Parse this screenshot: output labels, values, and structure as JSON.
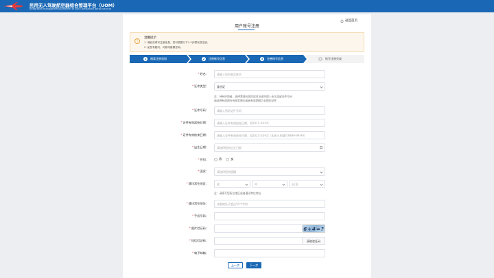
{
  "header": {
    "title": "民用无人驾驶航空器综合管理平台（UOM）",
    "subtitle": "Integrated management platform of civil unmanned aerial vehicle",
    "brand_color": "#1a68b5"
  },
  "page": {
    "home_link": "返回首页",
    "title": "用户账号注册"
  },
  "notice": {
    "title": "温馨提示",
    "lines": [
      "1. 请如实填写注册信息，您可根据以下1-5步骤完成注册。",
      "2. 如您有疑问，可致电客服咨询。"
    ]
  },
  "steps": [
    {
      "num": "1",
      "label": "阅读注册须知",
      "state": "done"
    },
    {
      "num": "2",
      "label": "注册账号信息",
      "state": "done"
    },
    {
      "num": "3",
      "label": "完善账号信息",
      "state": "current"
    },
    {
      "num": "4",
      "label": "账号注册完成",
      "state": "todo"
    }
  ],
  "form": {
    "name": {
      "label": "姓名",
      "placeholder": "请输入您的真实姓名"
    },
    "id_type": {
      "label": "证件类型",
      "value": "身份证"
    },
    "id_type_hint": [
      "注：持有护照者，选择港澳台居民居住证或外国人永久居留证件号码",
      "请选择有效期在有效范围内或者有效期限为长期的证件"
    ],
    "id_number": {
      "label": "证件号码",
      "placeholder": "请输入您的证件号码"
    },
    "valid_start": {
      "label": "证件有效起始日期",
      "placeholder": "请输入证件有效起始日期，如2021-XX-XX"
    },
    "valid_end": {
      "label": "证件有效结束日期",
      "placeholder": "请输入证件有效结束日期，如2021-XX-XX（如永久则填写9999-99-99）"
    },
    "birth_date": {
      "label": "出生日期",
      "placeholder": "请选择您的出生日期"
    },
    "gender": {
      "label": "性别",
      "options": [
        "男",
        "女"
      ]
    },
    "nationality": {
      "label": "国家",
      "placeholder": "请选择您的国籍"
    },
    "address": {
      "label": "通讯常住地区",
      "province": "省",
      "city": "市",
      "district": "区/县"
    },
    "address_hint": "注：请填写您所在地区或者通讯常住地址",
    "address_detail": {
      "label": "通讯常住地址",
      "placeholder": "详细地址不超过50个字符"
    },
    "phone": {
      "label": "手机号码",
      "placeholder": ""
    },
    "captcha": {
      "label": "图片验证码",
      "placeholder": "",
      "image_text": "6+4=?"
    },
    "sms_code": {
      "label": "短信验证码",
      "placeholder": "",
      "button": "获取验证码"
    },
    "email": {
      "label": "电子邮箱",
      "placeholder": ""
    }
  },
  "actions": {
    "prev": "上一步",
    "next": "下一步"
  }
}
